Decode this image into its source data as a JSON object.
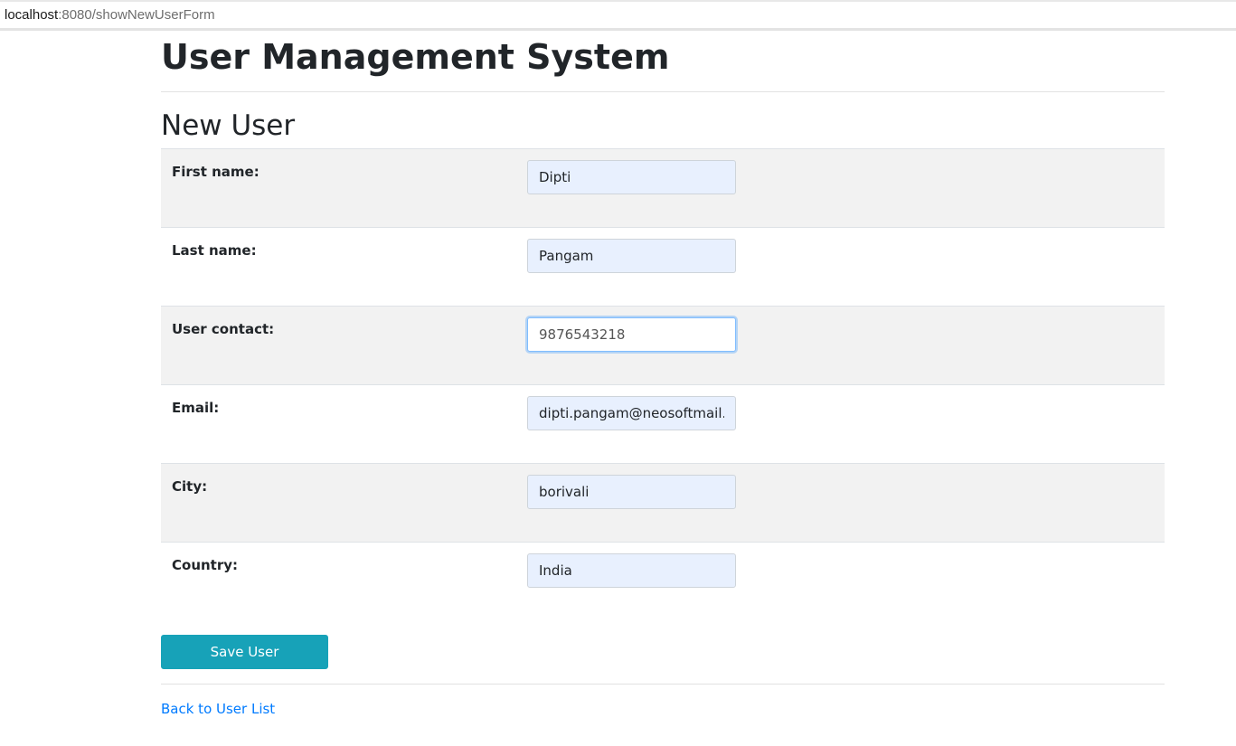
{
  "browser": {
    "url_host": "localhost",
    "url_rest": ":8080/showNewUserForm"
  },
  "header": {
    "app_title": "User Management System"
  },
  "form": {
    "title": "New User",
    "fields": [
      {
        "label": "First name:",
        "value": "Dipti"
      },
      {
        "label": "Last name:",
        "value": "Pangam"
      },
      {
        "label": "User contact:",
        "value": "9876543218"
      },
      {
        "label": "Email:",
        "value": "dipti.pangam@neosoftmail.com"
      },
      {
        "label": "City:",
        "value": "borivali"
      },
      {
        "label": "Country:",
        "value": "India"
      }
    ],
    "save_label": "Save User"
  },
  "footer": {
    "back_link": "Back to User List"
  },
  "colors": {
    "button": "#17a2b8",
    "link": "#007bff",
    "stripe": "#f2f2f2",
    "autofill": "#e8f0fe"
  }
}
